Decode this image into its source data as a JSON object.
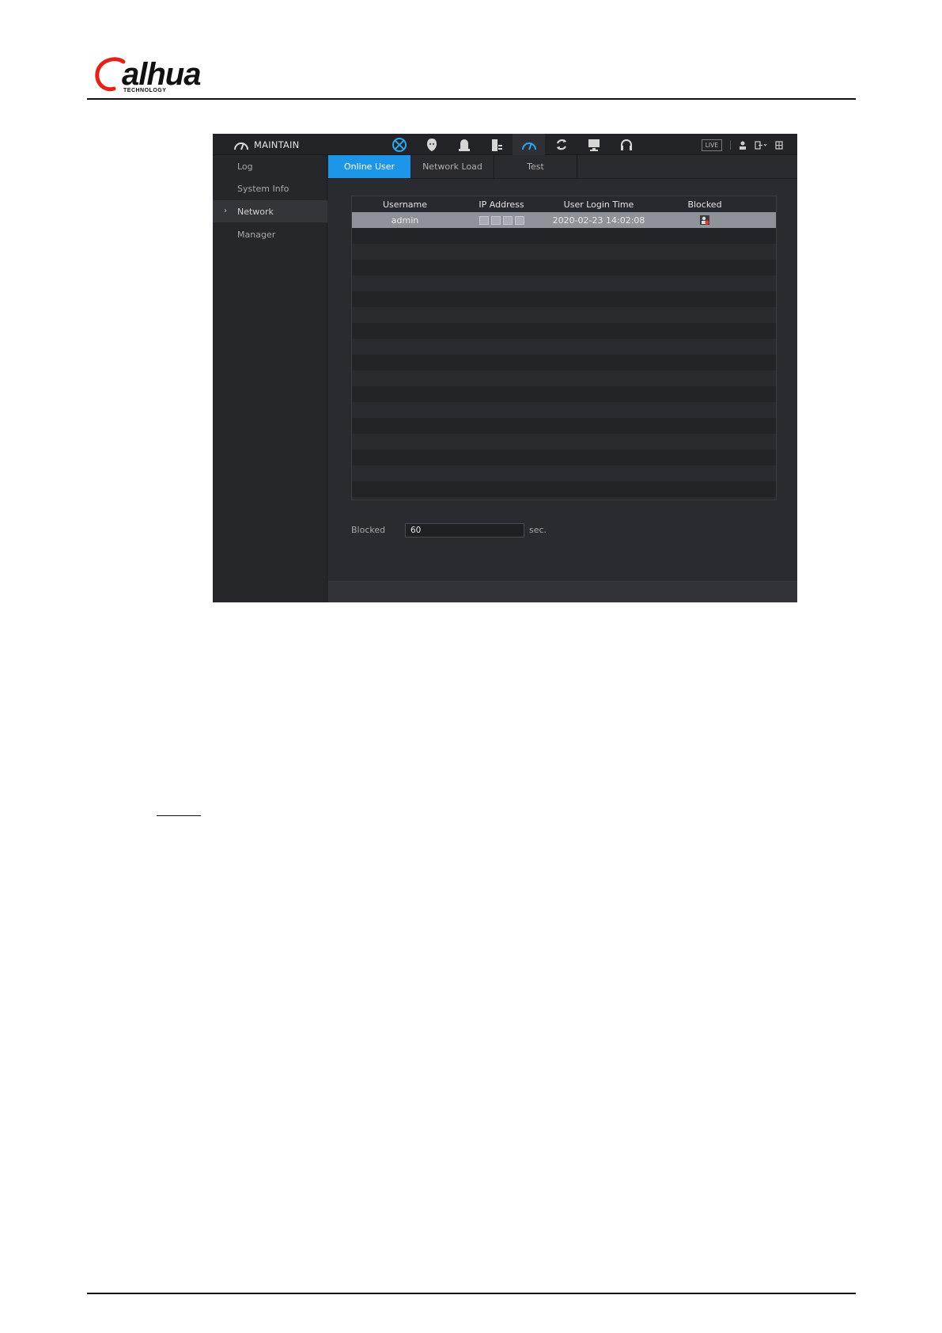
{
  "document": {
    "logo": {
      "wordmark": "alhua",
      "subtitle": "TECHNOLOGY",
      "colors": {
        "ring": "#e2231a",
        "text": "#111111"
      }
    }
  },
  "app": {
    "title": "MAINTAIN",
    "toolbar_icons": [
      "network-icon",
      "face-icon",
      "alarm-icon",
      "storage-icon",
      "maintain-icon",
      "backup-icon",
      "display-icon",
      "audio-icon"
    ],
    "live_label": "LIVE",
    "right_icons": [
      "user-icon",
      "logout-icon",
      "grid-icon"
    ]
  },
  "sidebar": {
    "items": [
      {
        "label": "Log"
      },
      {
        "label": "System Info"
      },
      {
        "label": "Network",
        "active": true
      },
      {
        "label": "Manager"
      }
    ]
  },
  "tabs": [
    {
      "label": "Online User",
      "active": true
    },
    {
      "label": "Network Load"
    },
    {
      "label": "Test"
    }
  ],
  "table": {
    "columns": [
      "Username",
      "IP Address",
      "User Login Time",
      "Blocked"
    ],
    "rows": [
      {
        "username": "admin",
        "ip": "",
        "login_time": "2020-02-23 14:02:08",
        "blocked_icon": "block-user-icon"
      }
    ]
  },
  "blocked": {
    "label": "Blocked",
    "value": "60",
    "unit": "sec."
  },
  "colors": {
    "accent": "#1d96e9",
    "panel_bg": "#2a2b30",
    "selected_row": "#8f9299"
  }
}
